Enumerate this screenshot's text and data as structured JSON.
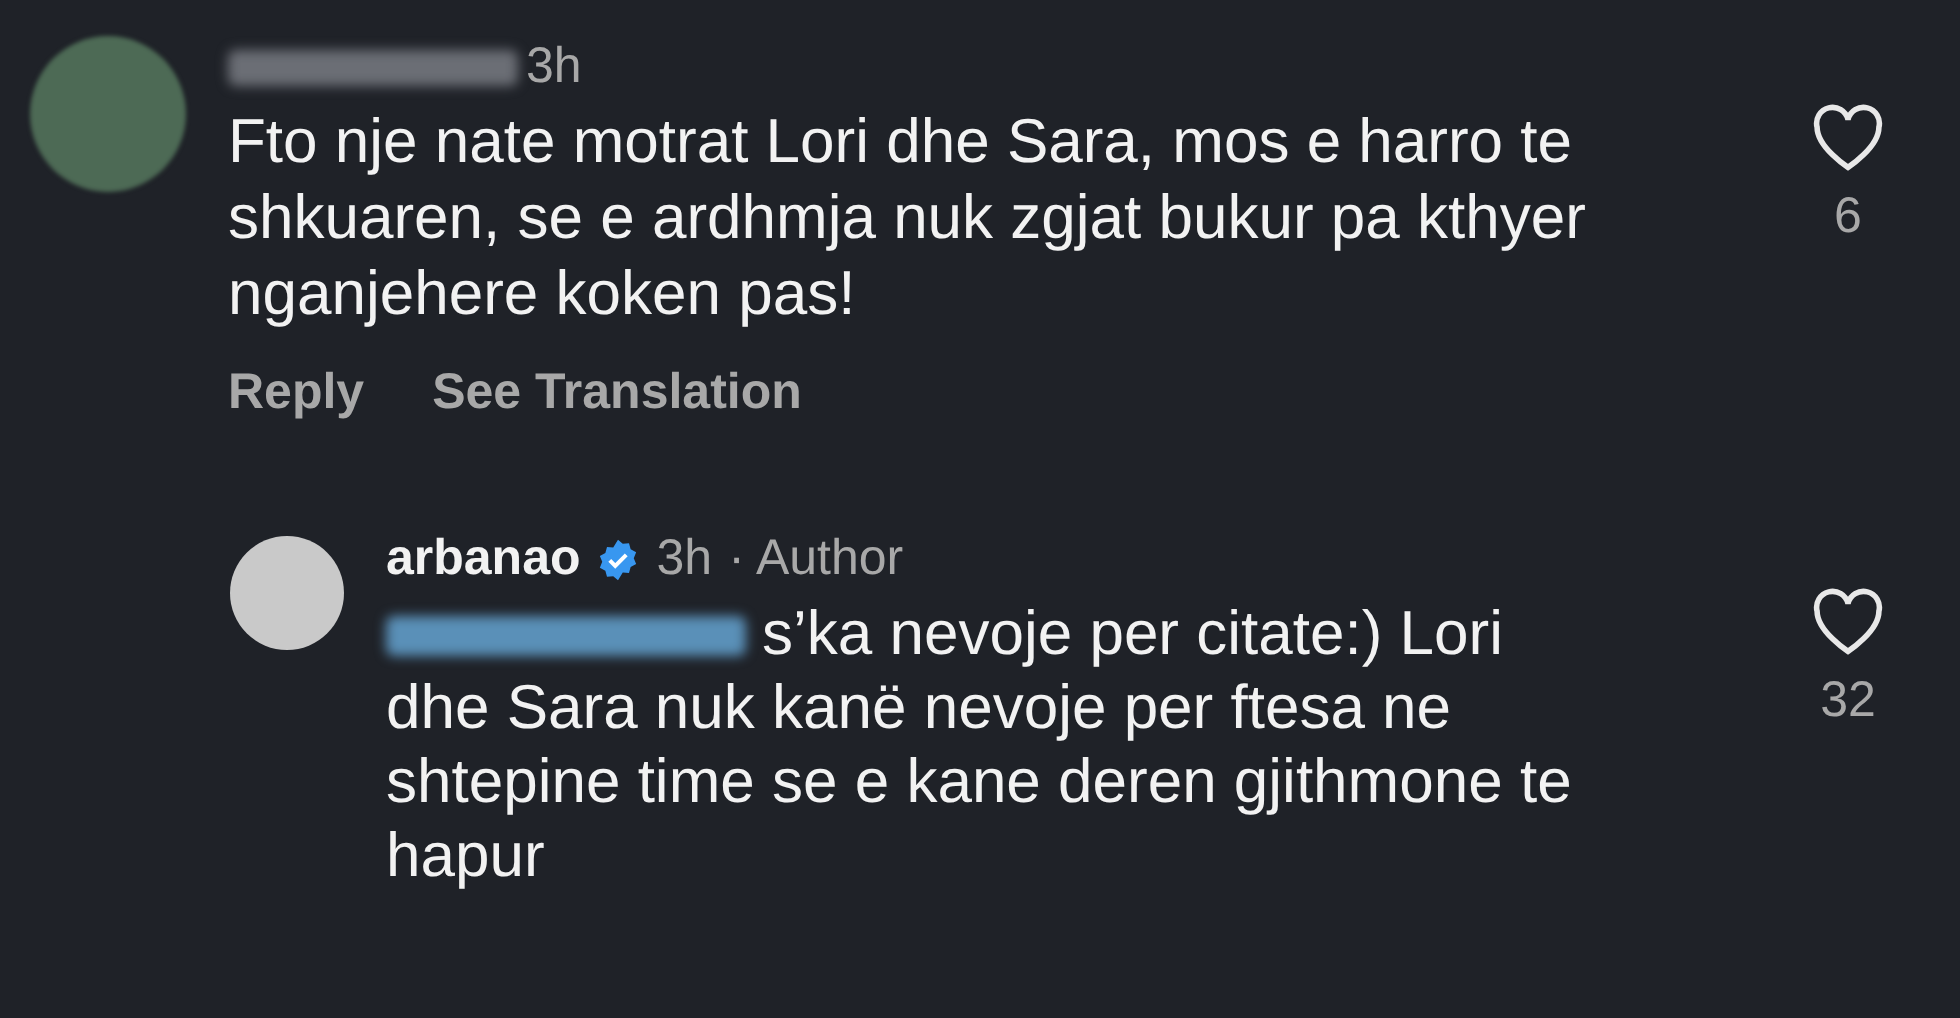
{
  "comments": [
    {
      "username_redacted": true,
      "time": "3h",
      "text": "Fto nje nate motrat Lori dhe Sara, mos e harro te shkuaren, se e ardhmja nuk zgjat bukur pa kthyer nganjehere koken pas!",
      "likes": "6",
      "actions": [
        "Reply",
        "See Translation"
      ],
      "replies": [
        {
          "username": "arbanao",
          "verified": true,
          "time": "3h",
          "author_label": "· Author",
          "mention_redacted": true,
          "text": "s’ka nevoje per citate:) Lori dhe Sara nuk kanë nevoje per ftesa ne shtepine time se e kane deren gjithmone te hapur",
          "likes": "32"
        }
      ]
    }
  ]
}
